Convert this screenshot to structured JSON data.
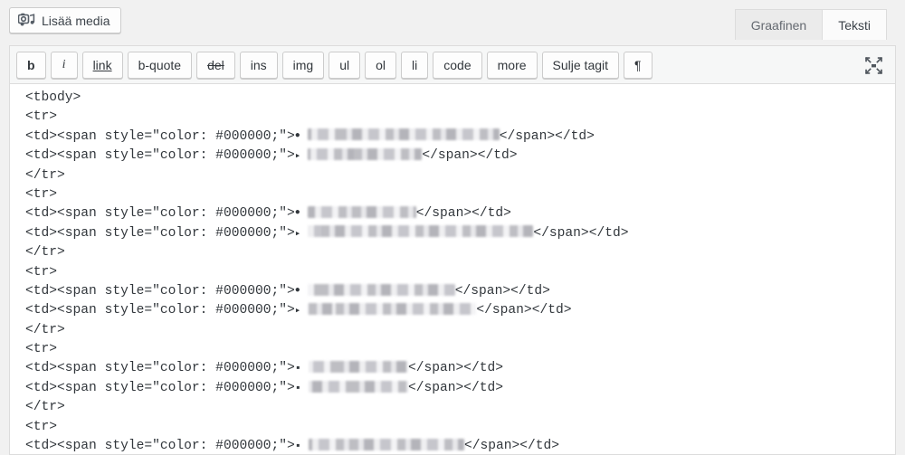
{
  "app": {
    "name": "WordPress Post Editor",
    "locale": "fi",
    "background_color": "#f1f1f1"
  },
  "media": {
    "add_media_label": "Lisää media",
    "icon": "add-media-icon"
  },
  "editor_tabs": {
    "visual_label": "Graafinen",
    "text_label": "Teksti",
    "active": "Teksti"
  },
  "quicktags": {
    "buttons": [
      {
        "label": "b",
        "style": "bold",
        "name": "bold"
      },
      {
        "label": "i",
        "style": "italic",
        "name": "italic"
      },
      {
        "label": "link",
        "style": "underline",
        "name": "link"
      },
      {
        "label": "b-quote",
        "style": "normal",
        "name": "blockquote"
      },
      {
        "label": "del",
        "style": "strikethrough",
        "name": "del"
      },
      {
        "label": "ins",
        "style": "normal",
        "name": "ins"
      },
      {
        "label": "img",
        "style": "normal",
        "name": "img"
      },
      {
        "label": "ul",
        "style": "normal",
        "name": "ul"
      },
      {
        "label": "ol",
        "style": "normal",
        "name": "ol"
      },
      {
        "label": "li",
        "style": "normal",
        "name": "li"
      },
      {
        "label": "code",
        "style": "normal",
        "name": "code"
      },
      {
        "label": "more",
        "style": "normal",
        "name": "more"
      },
      {
        "label": "Sulje tagit",
        "style": "normal",
        "name": "close-tags"
      },
      {
        "label": "¶",
        "style": "normal",
        "name": "pilcrow"
      }
    ],
    "fullscreen_icon": "distraction-free-writing-icon"
  },
  "code_editor": {
    "language": "html",
    "text_color": "#000000",
    "span_color_value": "#000000",
    "lines": [
      {
        "type": "tag",
        "text": "<tbody>"
      },
      {
        "type": "tag",
        "text": "<tr>"
      },
      {
        "type": "cell",
        "prefix": "<td><span style=\"color: #000000;\">",
        "bullet": "dot",
        "redacted_width": 212,
        "suffix": "</span></td>"
      },
      {
        "type": "cell",
        "prefix": "<td><span style=\"color: #000000;\">",
        "bullet": "tri",
        "redacted_width": 126,
        "suffix": "</span></td>"
      },
      {
        "type": "tag",
        "text": "</tr>"
      },
      {
        "type": "tag",
        "text": "<tr>"
      },
      {
        "type": "cell",
        "prefix": "<td><span style=\"color: #000000;\">",
        "bullet": "dot",
        "redacted_width": 120,
        "suffix": "</span></td>"
      },
      {
        "type": "cell",
        "prefix": "<td><span style=\"color: #000000;\">",
        "bullet": "tri",
        "redacted_width": 249,
        "suffix": "</span></td>"
      },
      {
        "type": "tag",
        "text": "</tr>"
      },
      {
        "type": "tag",
        "text": "<tr>"
      },
      {
        "type": "cell",
        "prefix": "<td><span style=\"color: #000000;\">",
        "bullet": "dot",
        "redacted_width": 163,
        "suffix": "</span></td>"
      },
      {
        "type": "cell",
        "prefix": "<td><span style=\"color: #000000;\">",
        "bullet": "tri",
        "redacted_width": 186,
        "suffix": "</span></td>"
      },
      {
        "type": "tag",
        "text": "</tr>"
      },
      {
        "type": "tag",
        "text": "<tr>"
      },
      {
        "type": "cell",
        "prefix": "<td><span style=\"color: #000000;\">",
        "bullet": "sq",
        "redacted_width": 110,
        "suffix": "</span></td>"
      },
      {
        "type": "cell",
        "prefix": "<td><span style=\"color: #000000;\">",
        "bullet": "sq",
        "redacted_width": 110,
        "suffix": "</span></td>"
      },
      {
        "type": "tag",
        "text": "</tr>"
      },
      {
        "type": "tag",
        "text": "<tr>"
      },
      {
        "type": "cell",
        "prefix": "<td><span style=\"color: #000000;\">",
        "bullet": "sq",
        "redacted_width": 172,
        "suffix": "</span></td>"
      }
    ]
  }
}
